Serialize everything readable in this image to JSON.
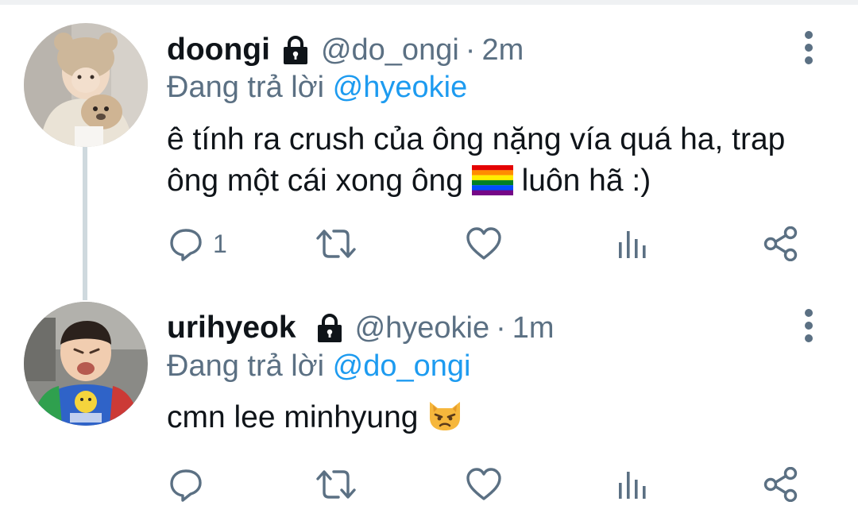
{
  "tweets": [
    {
      "display_name": "doongi",
      "handle": "@do_ongi",
      "time": "2m",
      "reply_prefix": "Đang trả lời",
      "reply_to": "@hyeokie",
      "text_line1": "ê tính ra crush của ông nặng vía quá ha, trap",
      "text_line2_before": "ông một cái xong ông",
      "text_line2_emoji": "rainbow-flag",
      "text_line2_after": "luôn hã :)",
      "reply_count": "1"
    },
    {
      "display_name": "urihyeok",
      "handle": "@hyeokie",
      "time": "1m",
      "reply_prefix": "Đang trả lời",
      "reply_to": "@do_ongi",
      "text_line1": "cmn lee minhyung",
      "text_emoji": "pouting-cat-face",
      "reply_count": ""
    }
  ],
  "separator": "·",
  "icons": {
    "lock": "lock-icon",
    "more": "more-vertical-icon",
    "reply": "reply-bubble-icon",
    "retweet": "retweet-icon",
    "like": "heart-icon",
    "analytics": "analytics-icon",
    "share": "share-icon"
  },
  "colors": {
    "text": "#0f1419",
    "secondary": "#5b7083",
    "mention": "#1d9bf0",
    "thread_line": "#cfd9de",
    "divider": "#eff1f3"
  }
}
